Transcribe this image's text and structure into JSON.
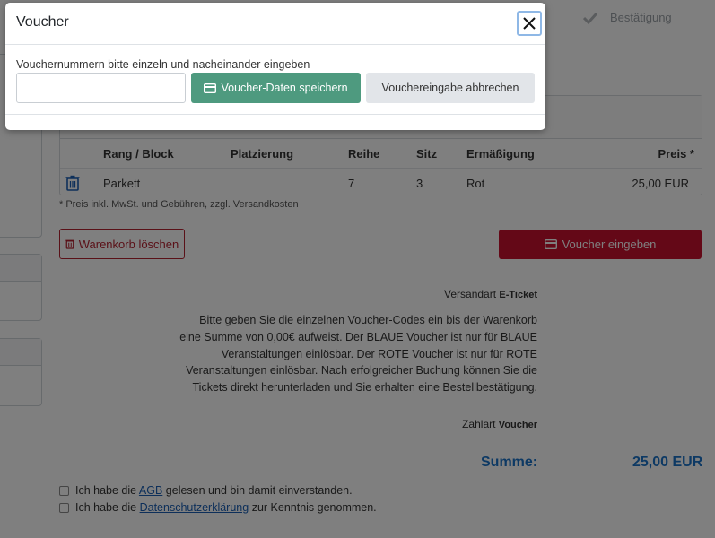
{
  "progress": {
    "step_label": "Bestätigung"
  },
  "cart": {
    "columns": {
      "rang": "Rang / Block",
      "platzierung": "Platzierung",
      "reihe": "Reihe",
      "sitz": "Sitz",
      "ermaessigung": "Ermäßigung",
      "preis": "Preis *"
    },
    "rows": [
      {
        "rang": "Parkett",
        "platzierung": "",
        "reihe": "7",
        "sitz": "3",
        "ermaessigung": "Rot",
        "preis": "25,00 EUR"
      }
    ],
    "note": "* Preis inkl. MwSt. und Gebühren, zzgl. Versandkosten"
  },
  "actions": {
    "clear_label": "Warenkorb löschen",
    "voucher_label": "Voucher eingeben"
  },
  "summary": {
    "shipping_label": "Versandart",
    "shipping_value": "E-Ticket",
    "info_text": "Bitte geben Sie die einzelnen Voucher-Codes ein bis der Warenkorb eine Summe von 0,00€ aufweist. Der BLAUE Voucher ist nur für BLAUE Veranstaltungen einlösbar. Der ROTE Voucher ist nur für ROTE Veranstaltungen einlösbar. Nach erfolgreicher Buchung können Sie die Tickets direkt herunterladen und Sie erhalten eine Bestellbestätigung.",
    "payment_label": "Zahlart",
    "payment_value": "Voucher",
    "sum_label": "Summe:",
    "sum_value": "25,00 EUR"
  },
  "consents": {
    "agb_prefix": "Ich habe die",
    "agb_link": "AGB",
    "agb_suffix": "gelesen und bin damit einverstanden.",
    "privacy_prefix": "Ich habe die",
    "privacy_link": "Datenschutzerklärung",
    "privacy_suffix": "zur Kenntnis genommen."
  },
  "modal": {
    "title": "Voucher",
    "instruction": "Vouchernummern bitte einzeln und nacheinander eingeben",
    "input_value": "",
    "input_placeholder": "",
    "save_label": "Voucher-Daten speichern",
    "cancel_label": "Vouchereingabe abbrechen"
  },
  "colors": {
    "primary_red": "#c8102e",
    "save_green": "#4e9a7f",
    "sum_blue": "#1a73c8",
    "link_blue": "#1a5fb4"
  },
  "icons": [
    "check-icon",
    "trash-icon",
    "card-icon",
    "close-icon"
  ]
}
